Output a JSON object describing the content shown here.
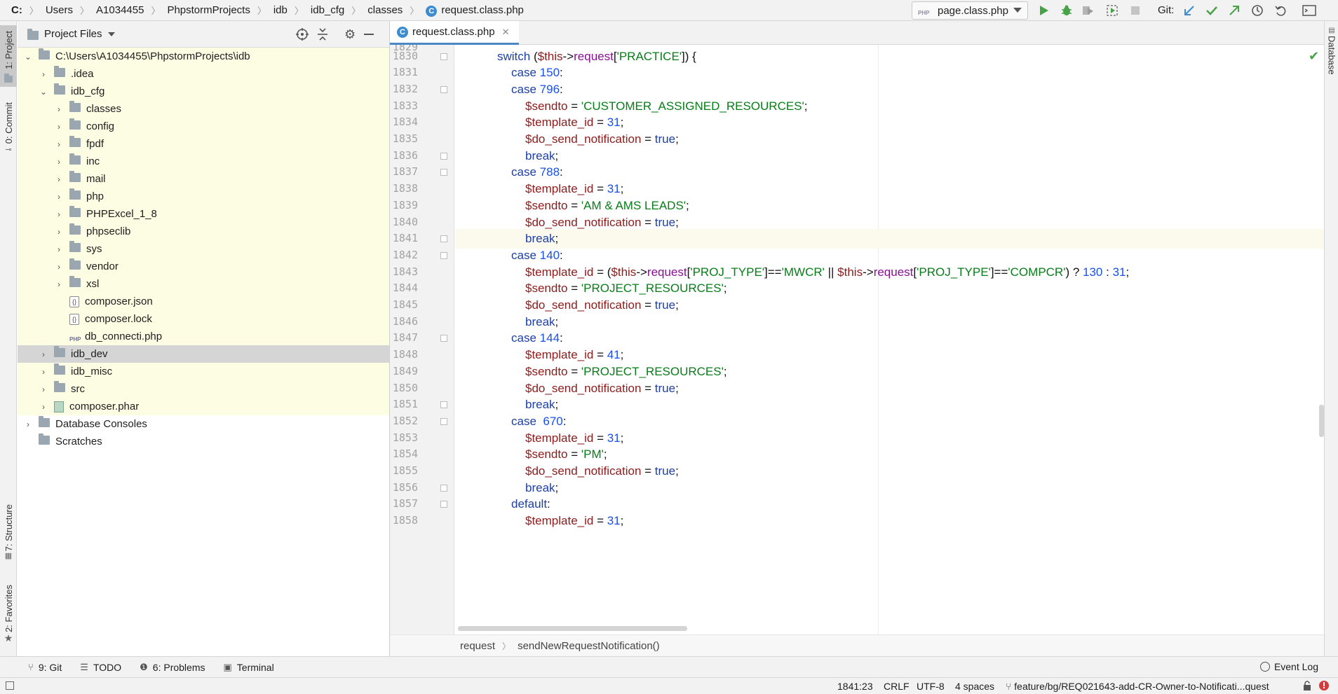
{
  "breadcrumbs": [
    "C:",
    "Users",
    "A1034455",
    "PhpstormProjects",
    "idb",
    "idb_cfg",
    "classes",
    "request.class.php"
  ],
  "toolbar": {
    "run_config": "page.class.php",
    "run_config_badge": "PHP",
    "git_label": "Git:",
    "icons": [
      "run-icon",
      "debug-icon",
      "coverage-icon",
      "profile-icon",
      "stop-icon",
      "git-update-icon",
      "git-commit-icon",
      "git-push-icon",
      "history-icon",
      "rollback-icon",
      "terminal-window-icon"
    ]
  },
  "left_tabs": {
    "project": "1: Project",
    "commit": "0: Commit",
    "structure": "7: Structure",
    "favorites": "2: Favorites"
  },
  "right_tabs": {
    "database": "Database"
  },
  "project_panel": {
    "title": "Project Files",
    "root": "C:\\Users\\A1034455\\PhpstormProjects\\idb",
    "items": [
      {
        "label": ".idea",
        "type": "folder"
      },
      {
        "label": "idb_cfg",
        "type": "folder"
      },
      {
        "label": "classes",
        "type": "folder"
      },
      {
        "label": "config",
        "type": "folder"
      },
      {
        "label": "fpdf",
        "type": "folder"
      },
      {
        "label": "inc",
        "type": "folder"
      },
      {
        "label": "mail",
        "type": "folder"
      },
      {
        "label": "php",
        "type": "folder"
      },
      {
        "label": "PHPExcel_1_8",
        "type": "folder"
      },
      {
        "label": "phpseclib",
        "type": "folder"
      },
      {
        "label": "sys",
        "type": "folder"
      },
      {
        "label": "vendor",
        "type": "folder"
      },
      {
        "label": "xsl",
        "type": "folder"
      },
      {
        "label": "composer.json",
        "type": "json"
      },
      {
        "label": "composer.lock",
        "type": "json"
      },
      {
        "label": "db_connecti.php",
        "type": "php"
      },
      {
        "label": "idb_dev",
        "type": "folder"
      },
      {
        "label": "idb_misc",
        "type": "folder"
      },
      {
        "label": "src",
        "type": "folder"
      },
      {
        "label": "composer.phar",
        "type": "phar"
      },
      {
        "label": "Database Consoles",
        "type": "folder"
      },
      {
        "label": "Scratches",
        "type": "folder"
      }
    ],
    "json_badge": "{}",
    "php_badge": "PHP"
  },
  "editor": {
    "tab": "request.class.php",
    "top_partial_line": "1829",
    "lines": [
      {
        "n": "1830",
        "code": "switch ($this->request['PRACTICE']) {"
      },
      {
        "n": "1831",
        "code": "case 150:"
      },
      {
        "n": "1832",
        "code": "case 796:"
      },
      {
        "n": "1833",
        "code": "$sendto = 'CUSTOMER_ASSIGNED_RESOURCES';"
      },
      {
        "n": "1834",
        "code": "$template_id = 31;"
      },
      {
        "n": "1835",
        "code": "$do_send_notification = true;"
      },
      {
        "n": "1836",
        "code": "break;"
      },
      {
        "n": "1837",
        "code": "case 788:"
      },
      {
        "n": "1838",
        "code": "$template_id = 31;"
      },
      {
        "n": "1839",
        "code": "$sendto = 'AM & AMS LEADS';"
      },
      {
        "n": "1840",
        "code": "$do_send_notification = true;"
      },
      {
        "n": "1841",
        "code": "break;"
      },
      {
        "n": "1842",
        "code": "case 140:"
      },
      {
        "n": "1843",
        "code": "$template_id = ($this->request['PROJ_TYPE']=='MWCR' || $this->request['PROJ_TYPE']=='COMPCR') ? 130 : 31;"
      },
      {
        "n": "1844",
        "code": "$sendto = 'PROJECT_RESOURCES';"
      },
      {
        "n": "1845",
        "code": "$do_send_notification = true;"
      },
      {
        "n": "1846",
        "code": "break;"
      },
      {
        "n": "1847",
        "code": "case 144:"
      },
      {
        "n": "1848",
        "code": "$template_id = 41;"
      },
      {
        "n": "1849",
        "code": "$sendto = 'PROJECT_RESOURCES';"
      },
      {
        "n": "1850",
        "code": "$do_send_notification = true;"
      },
      {
        "n": "1851",
        "code": "break;"
      },
      {
        "n": "1852",
        "code": "case  670:"
      },
      {
        "n": "1853",
        "code": "$template_id = 31;"
      },
      {
        "n": "1854",
        "code": "$sendto = 'PM';"
      },
      {
        "n": "1855",
        "code": "$do_send_notification = true;"
      },
      {
        "n": "1856",
        "code": "break;"
      },
      {
        "n": "1857",
        "code": "default:"
      },
      {
        "n": "1858",
        "code": "$template_id = 31;"
      }
    ],
    "breadcrumb": [
      "request",
      "sendNewRequestNotification()"
    ]
  },
  "bottom_tabs": [
    {
      "label": "9: Git",
      "icon": "git-branch-icon"
    },
    {
      "label": "TODO",
      "icon": "list-icon"
    },
    {
      "label": "6: Problems",
      "icon": "info-icon"
    },
    {
      "label": "Terminal",
      "icon": "terminal-icon"
    }
  ],
  "event_log": "Event Log",
  "status": {
    "position": "1841:23",
    "line_sep": "CRLF",
    "encoding": "UTF-8",
    "indent": "4 spaces",
    "branch": "feature/bg/REQ021643-add-CR-Owner-to-Notificati...quest"
  },
  "colors": {
    "keyword": "#1d3fa5",
    "variable": "#8b1c1c",
    "number": "#1750eb",
    "string": "#067d17",
    "function": "#871094",
    "highlight": "#fdfde4",
    "accent": "#4a88c7"
  }
}
